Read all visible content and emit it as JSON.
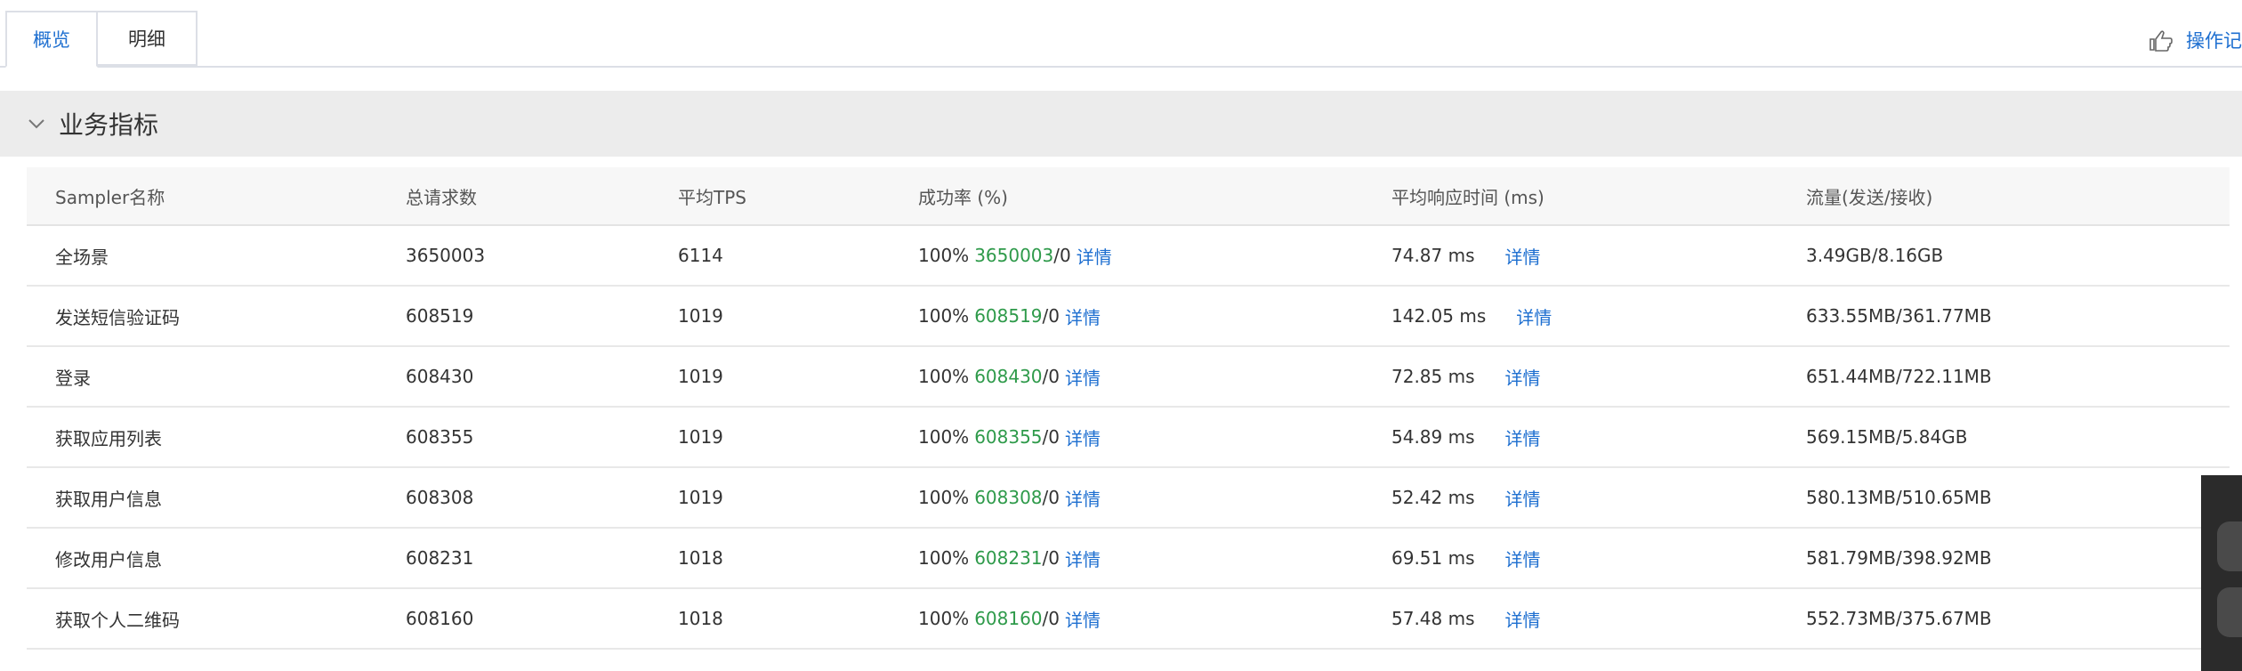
{
  "tabs": [
    {
      "label": "概览",
      "active": true
    },
    {
      "label": "明细",
      "active": false
    }
  ],
  "oplog": {
    "label": "操作记",
    "icon": "pointing-hand-icon"
  },
  "section": {
    "title": "业务指标",
    "icon": "chevron-down-icon"
  },
  "colors": {
    "accent": "#1e6fd0",
    "success": "#2e9a4a",
    "section_bg": "#ececec"
  },
  "table": {
    "headers": {
      "sampler": "Sampler名称",
      "total": "总请求数",
      "tps": "平均TPS",
      "success": "成功率 (%)",
      "resp": "平均响应时间 (ms)",
      "traffic": "流量(发送/接收)"
    },
    "detail_label": "详情",
    "rows": [
      {
        "name": "全场景",
        "total": "3650003",
        "tps": "6114",
        "rate": "100%",
        "ok": "3650003",
        "fail": "/0",
        "resp": "74.87 ms",
        "traffic": "3.49GB/8.16GB"
      },
      {
        "name": "发送短信验证码",
        "total": "608519",
        "tps": "1019",
        "rate": "100%",
        "ok": "608519",
        "fail": "/0",
        "resp": "142.05 ms",
        "traffic": "633.55MB/361.77MB"
      },
      {
        "name": "登录",
        "total": "608430",
        "tps": "1019",
        "rate": "100%",
        "ok": "608430",
        "fail": "/0",
        "resp": "72.85 ms",
        "traffic": "651.44MB/722.11MB"
      },
      {
        "name": "获取应用列表",
        "total": "608355",
        "tps": "1019",
        "rate": "100%",
        "ok": "608355",
        "fail": "/0",
        "resp": "54.89 ms",
        "traffic": "569.15MB/5.84GB"
      },
      {
        "name": "获取用户信息",
        "total": "608308",
        "tps": "1019",
        "rate": "100%",
        "ok": "608308",
        "fail": "/0",
        "resp": "52.42 ms",
        "traffic": "580.13MB/510.65MB"
      },
      {
        "name": "修改用户信息",
        "total": "608231",
        "tps": "1018",
        "rate": "100%",
        "ok": "608231",
        "fail": "/0",
        "resp": "69.51 ms",
        "traffic": "581.79MB/398.92MB"
      },
      {
        "name": "获取个人二维码",
        "total": "608160",
        "tps": "1018",
        "rate": "100%",
        "ok": "608160",
        "fail": "/0",
        "resp": "57.48 ms",
        "traffic": "552.73MB/375.67MB"
      }
    ]
  }
}
